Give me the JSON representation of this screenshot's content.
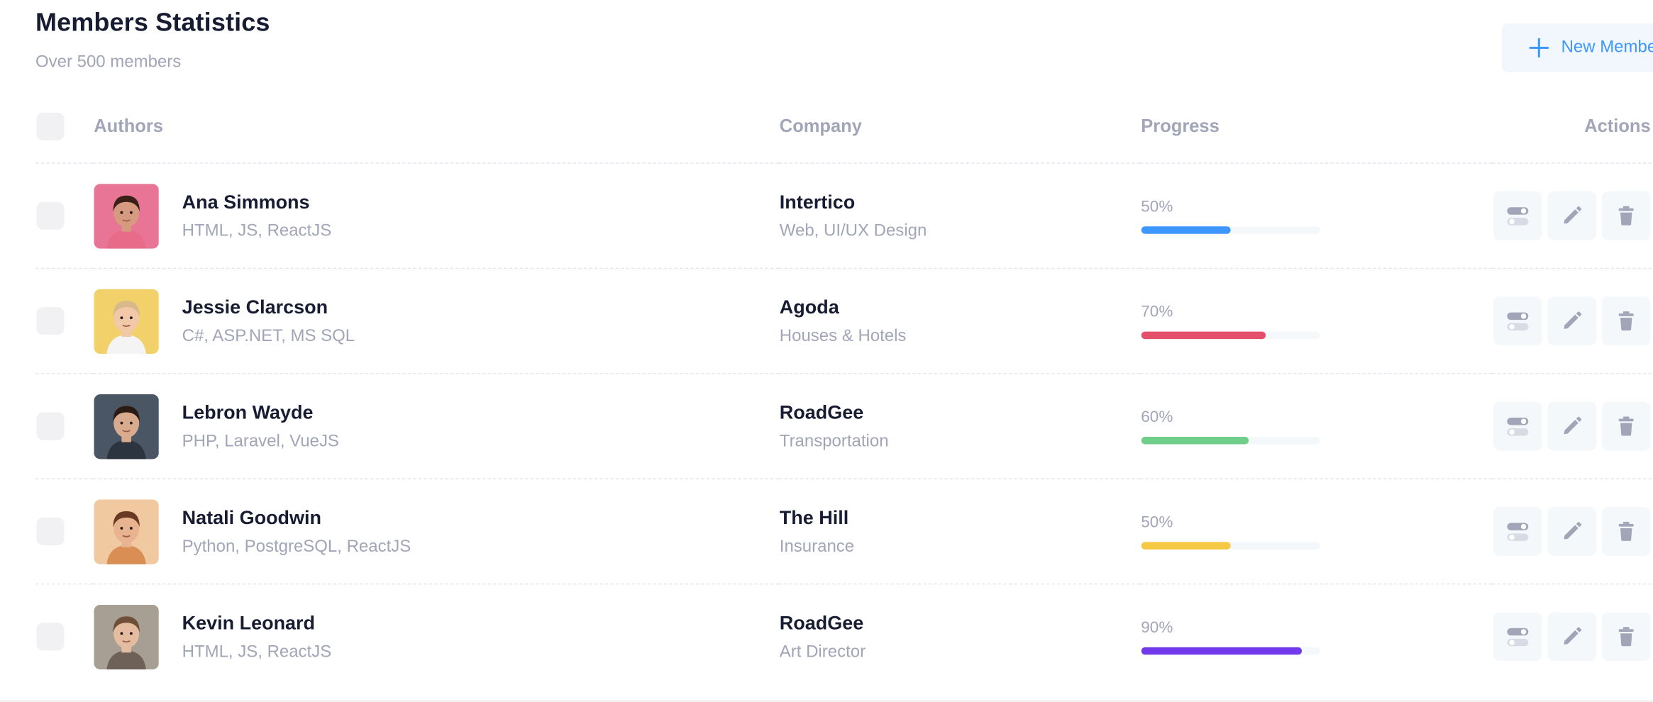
{
  "header": {
    "title": "Members Statistics",
    "subtitle": "Over 500 members",
    "new_button_label": "New Member"
  },
  "table": {
    "columns": {
      "authors": "Authors",
      "company": "Company",
      "progress": "Progress",
      "actions": "Actions"
    },
    "rows": [
      {
        "name": "Ana Simmons",
        "skills": "HTML, JS, ReactJS",
        "company": "Intertico",
        "company_type": "Web, UI/UX Design",
        "progress_label": "50%",
        "progress": 50,
        "bar_color": "#3e97ff"
      },
      {
        "name": "Jessie Clarcson",
        "skills": "C#, ASP.NET, MS SQL",
        "company": "Agoda",
        "company_type": "Houses & Hotels",
        "progress_label": "70%",
        "progress": 70,
        "bar_color": "#e4506a"
      },
      {
        "name": "Lebron Wayde",
        "skills": "PHP, Laravel, VueJS",
        "company": "RoadGee",
        "company_type": "Transportation",
        "progress_label": "60%",
        "progress": 60,
        "bar_color": "#6fcf8a"
      },
      {
        "name": "Natali Goodwin",
        "skills": "Python, PostgreSQL, ReactJS",
        "company": "The Hill",
        "company_type": "Insurance",
        "progress_label": "50%",
        "progress": 50,
        "bar_color": "#f6c944"
      },
      {
        "name": "Kevin Leonard",
        "skills": "HTML, JS, ReactJS",
        "company": "RoadGee",
        "company_type": "Art Director",
        "progress_label": "90%",
        "progress": 90,
        "bar_color": "#7239ea"
      }
    ]
  },
  "avatars": [
    {
      "bg": "#e87596",
      "skin": "#d69a80",
      "hair": "#3b2018",
      "shirt": "#e86c8a"
    },
    {
      "bg": "#f2d16b",
      "skin": "#f1c8a8",
      "hair": "#d9b98c",
      "shirt": "#f4f4f4"
    },
    {
      "bg": "#4a5663",
      "skin": "#d8ab8e",
      "hair": "#2a1b14",
      "shirt": "#2c3440"
    },
    {
      "bg": "#f0c9a0",
      "skin": "#e7b390",
      "hair": "#6a3b22",
      "shirt": "#d98e54"
    },
    {
      "bg": "#a79f93",
      "skin": "#e4bda0",
      "hair": "#6e5038",
      "shirt": "#6e6258"
    }
  ],
  "icons": {
    "toggle": "toggle-icon",
    "edit": "pencil-icon",
    "delete": "trash-icon"
  }
}
